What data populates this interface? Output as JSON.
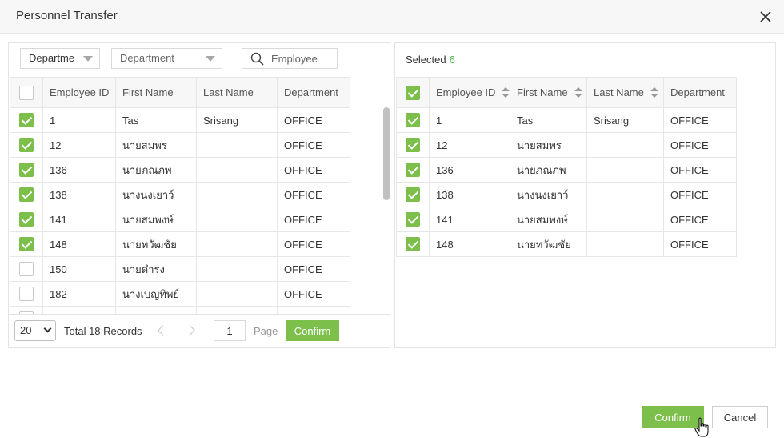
{
  "dialog": {
    "title": "Personnel Transfer",
    "close_icon": "close-icon"
  },
  "left": {
    "filter_type": "Departme",
    "filter_department_placeholder": "Department",
    "search_placeholder": "Employee",
    "columns": [
      "Employee ID",
      "First Name",
      "Last Name",
      "Department"
    ],
    "rows": [
      {
        "checked": true,
        "id": "1",
        "first": "Tas",
        "last": "Srisang",
        "dept": "OFFICE"
      },
      {
        "checked": true,
        "id": "12",
        "first": "นายสมพร",
        "last": "",
        "dept": "OFFICE"
      },
      {
        "checked": true,
        "id": "136",
        "first": "นายภณภพ",
        "last": "",
        "dept": "OFFICE"
      },
      {
        "checked": true,
        "id": "138",
        "first": "นางนงเยาว์",
        "last": "",
        "dept": "OFFICE"
      },
      {
        "checked": true,
        "id": "141",
        "first": "นายสมพงษ์",
        "last": "",
        "dept": "OFFICE"
      },
      {
        "checked": true,
        "id": "148",
        "first": "นายทวัฒชัย",
        "last": "",
        "dept": "OFFICE"
      },
      {
        "checked": false,
        "id": "150",
        "first": "นายดำรง",
        "last": "",
        "dept": "OFFICE"
      },
      {
        "checked": false,
        "id": "182",
        "first": "นางเบญทิพย์",
        "last": "",
        "dept": "OFFICE"
      },
      {
        "checked": false,
        "id": "",
        "first": "",
        "last": "",
        "dept": ""
      }
    ],
    "pager": {
      "page_size": "20",
      "total": "Total 18 Records",
      "page": "1",
      "page_label": "Page",
      "confirm": "Confirm"
    }
  },
  "right": {
    "selected_label": "Selected",
    "selected_count": "6",
    "columns": [
      "Employee ID",
      "First Name",
      "Last Name",
      "Department"
    ],
    "rows": [
      {
        "id": "1",
        "first": "Tas",
        "last": "Srisang",
        "dept": "OFFICE"
      },
      {
        "id": "12",
        "first": "นายสมพร",
        "last": "",
        "dept": "OFFICE"
      },
      {
        "id": "136",
        "first": "นายภณภพ",
        "last": "",
        "dept": "OFFICE"
      },
      {
        "id": "138",
        "first": "นางนงเยาว์",
        "last": "",
        "dept": "OFFICE"
      },
      {
        "id": "141",
        "first": "นายสมพงษ์",
        "last": "",
        "dept": "OFFICE"
      },
      {
        "id": "148",
        "first": "นายทวัฒชัย",
        "last": "",
        "dept": "OFFICE"
      }
    ]
  },
  "footer": {
    "confirm": "Confirm",
    "cancel": "Cancel"
  },
  "colors": {
    "accent": "#7cc04b",
    "count": "#4caf50"
  }
}
